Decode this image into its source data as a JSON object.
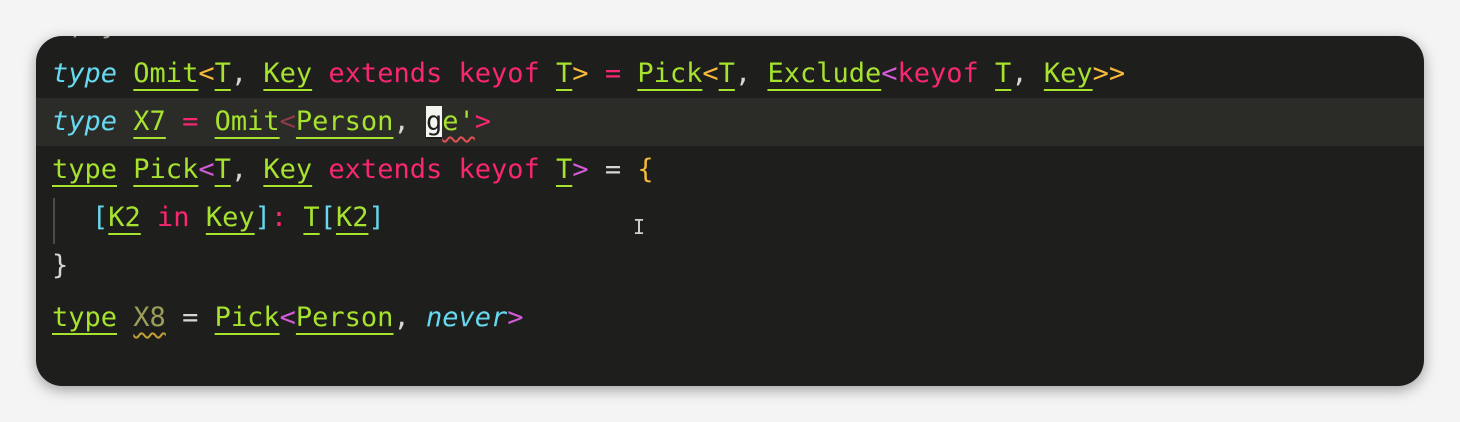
{
  "editor": {
    "cropped_line": "', }",
    "line1": {
      "kw_type": "type",
      "omit": "Omit",
      "lt": "<",
      "t1": "T",
      "comma1": ", ",
      "key1": "Key",
      "extends": "extends",
      "keyof": "keyof",
      "t2": "T",
      "gt": ">",
      "eq": "=",
      "pick": "Pick",
      "lt2": "<",
      "t3": "T",
      "comma2": ", ",
      "exclude": "Exclude",
      "lt3": "<",
      "keyof2": "keyof",
      "t4": "T",
      "comma3": ", ",
      "key2": "Key",
      "gtgt": ">>"
    },
    "line2": {
      "kw_type": "type",
      "x7": "X7",
      "eq": "=",
      "omit": "Omit",
      "lt": "<",
      "person": "Person",
      "comma": ", ",
      "cursor_char": "g",
      "rest": "e'",
      "gt": ">"
    },
    "line3": {
      "kw_type": "type",
      "pick": "Pick",
      "lt": "<",
      "t1": "T",
      "comma": ", ",
      "key": "Key",
      "extends": "extends",
      "keyof": "keyof",
      "t2": "T",
      "gt": ">",
      "eq": "=",
      "brace": "{"
    },
    "line4": {
      "lb": "[",
      "k2a": "K2",
      "in": "in",
      "key": "Key",
      "rb": "]",
      "colon": ":",
      "t": "T",
      "lb2": "[",
      "k2b": "K2",
      "rb2": "]"
    },
    "line5": {
      "brace": "}"
    },
    "line6": {
      "kw_type": "type",
      "x8": "X8",
      "eq": "=",
      "pick": "Pick",
      "lt": "<",
      "person": "Person",
      "comma": ", ",
      "never": "never",
      "gt": ">"
    },
    "mouse_cursor": "I"
  },
  "colors": {
    "background": "#1e1f1c",
    "type_keyword": "#66d9ef",
    "identifier": "#a6e22e",
    "operator_keyword": "#f92672",
    "angle_bracket": "#f6b93b",
    "current_line": "#2b2b28"
  }
}
